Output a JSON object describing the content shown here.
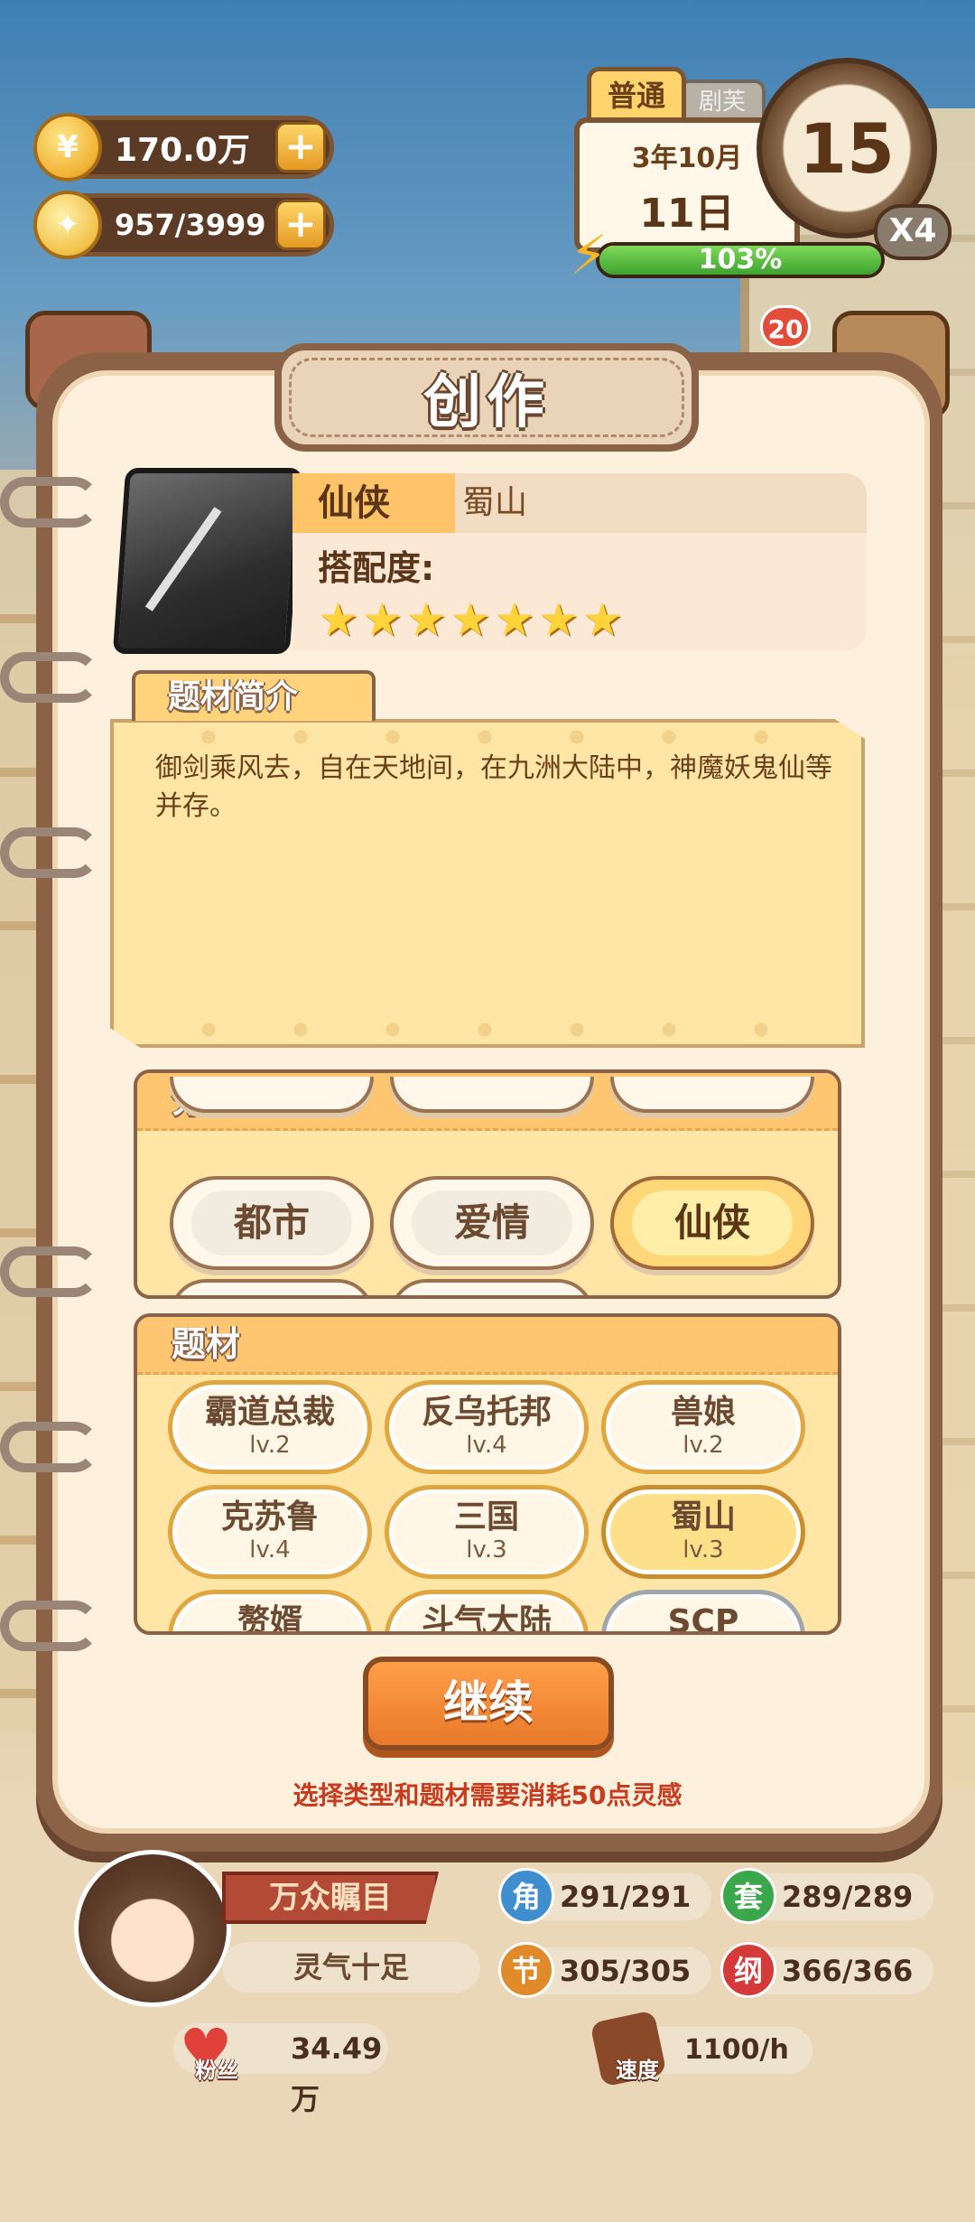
{
  "hud": {
    "coins": "170.0万",
    "inspiration": "957/3999",
    "plus": "+",
    "calendar_mode": "普通",
    "calendar_other_tab": "剧芙",
    "year_month": "3年10月",
    "day": "11日",
    "clock_value": "15",
    "speed_multiplier": "X4",
    "energy_percent": "103%",
    "energy_fill": 1.0,
    "notification_count": "20"
  },
  "dialog": {
    "title": "创作",
    "genre": "仙侠",
    "topic": "蜀山",
    "match_label": "搭配度:",
    "match_stars": 7,
    "description_tab": "题材简介",
    "description": "御剑乘风去，自在天地间，在九洲大陆中，神魔妖鬼仙等并存。"
  },
  "categories": {
    "header": "分类",
    "items": [
      {
        "label": "都市",
        "selected": false
      },
      {
        "label": "爱情",
        "selected": false
      },
      {
        "label": "仙侠",
        "selected": true
      }
    ]
  },
  "topics": {
    "header": "题材",
    "items": [
      {
        "label": "霸道总裁",
        "level": "lv.2",
        "selected": false
      },
      {
        "label": "反乌托邦",
        "level": "lv.4",
        "selected": false
      },
      {
        "label": "兽娘",
        "level": "lv.2",
        "selected": false
      },
      {
        "label": "克苏鲁",
        "level": "lv.4",
        "selected": false
      },
      {
        "label": "三国",
        "level": "lv.3",
        "selected": false
      },
      {
        "label": "蜀山",
        "level": "lv.3",
        "selected": true
      },
      {
        "label": "赘婿",
        "level": "",
        "selected": false
      },
      {
        "label": "斗气大陆",
        "level": "",
        "selected": false
      },
      {
        "label": "SCP",
        "level": "",
        "selected": false
      }
    ]
  },
  "actions": {
    "continue": "继续",
    "cost_note": "选择类型和题材需要消耗50点灵感"
  },
  "status": {
    "title": "万众瞩目",
    "mood": "灵气十足",
    "fans_label": "粉丝",
    "fans": "34.49万",
    "stats": [
      {
        "icon": "角",
        "value": "291/291",
        "color": "#3f8fd0"
      },
      {
        "icon": "套",
        "value": "289/289",
        "color": "#3aa84a"
      },
      {
        "icon": "节",
        "value": "305/305",
        "color": "#e08a2a"
      },
      {
        "icon": "纲",
        "value": "366/366",
        "color": "#d43a3a"
      }
    ],
    "speed_label": "速度",
    "speed": "1100/h"
  }
}
